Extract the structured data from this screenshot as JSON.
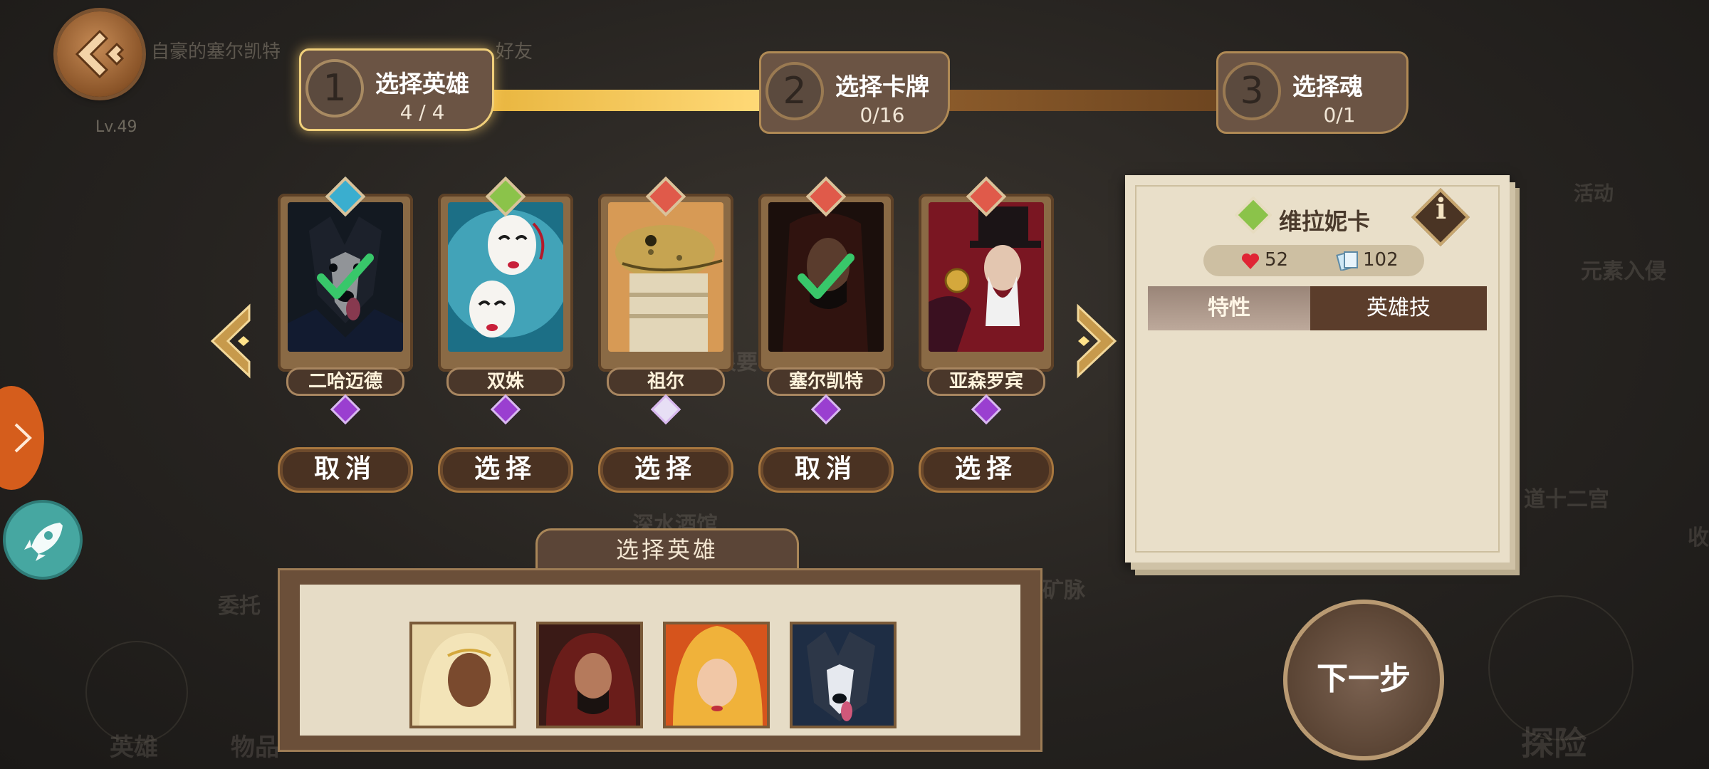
{
  "player": {
    "name": "自豪的塞尔凯特",
    "level": "Lv.49",
    "friend_text": "好友"
  },
  "background": {
    "labels": [
      "活动",
      "元素入侵",
      "道十二宫",
      "收",
      "委托",
      "矿脉",
      "深水酒馆",
      "很要",
      "英雄",
      "物品",
      "探险"
    ]
  },
  "steps": [
    {
      "num": "1",
      "title": "选择英雄",
      "count": "4 / 4",
      "active": true
    },
    {
      "num": "2",
      "title": "选择卡牌",
      "count": "0/16",
      "active": false
    },
    {
      "num": "3",
      "title": "选择魂",
      "count": "0/1",
      "active": false
    }
  ],
  "heroes": [
    {
      "name": "二哈迈德",
      "action": "取消",
      "selected": true,
      "top_gem_color": "#3aaecf",
      "portrait": "husky"
    },
    {
      "name": "双姝",
      "action": "选择",
      "selected": false,
      "top_gem_color": "#8bc34a",
      "portrait": "masks"
    },
    {
      "name": "祖尔",
      "action": "选择",
      "selected": false,
      "top_gem_color": "#e05a4a",
      "portrait": "lizard"
    },
    {
      "name": "塞尔凯特",
      "action": "取消",
      "selected": true,
      "top_gem_color": "#e05a4a",
      "portrait": "woman"
    },
    {
      "name": "亚森罗宾",
      "action": "选择",
      "selected": false,
      "top_gem_color": "#e05a4a",
      "portrait": "magician"
    }
  ],
  "panel": {
    "hero_name": "维拉妮卡",
    "hp": "52",
    "cards": "102",
    "tabs": [
      "特性",
      "英雄技"
    ],
    "info_label": "i"
  },
  "selection": {
    "label": "选择英雄",
    "slots": [
      "blonde-hero",
      "red-hair-hero",
      "fire-hero",
      "husky-hero"
    ]
  },
  "next_button": "下一步",
  "colors": {
    "accent": "#f0cf7a",
    "brown": "#6b5444",
    "panel": "#e9dfc9"
  }
}
